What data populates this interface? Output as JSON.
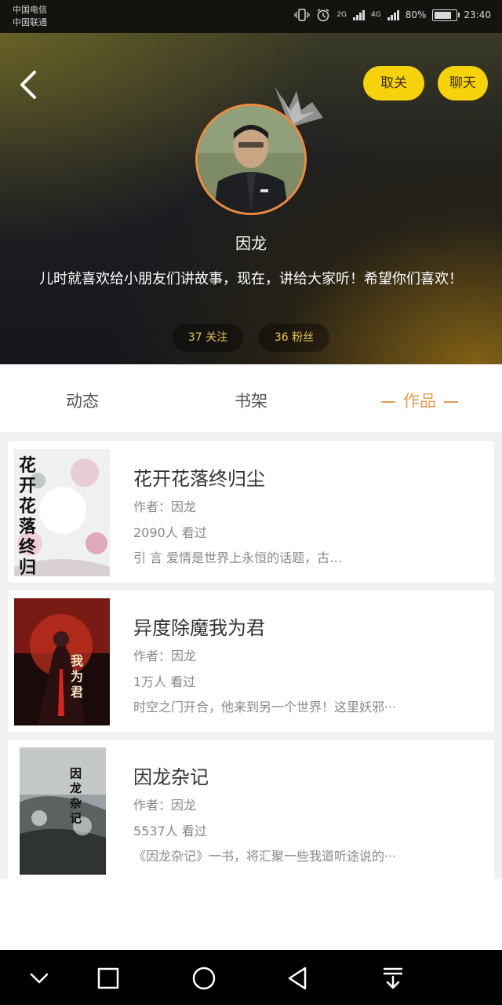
{
  "status_bar": {
    "carrier1": "中国电信",
    "carrier2": "中国联通",
    "net1": "2G",
    "net2": "4G",
    "battery_pct": "80%",
    "time": "23:40"
  },
  "header": {
    "follow_label": "取关",
    "chat_label": "聊天",
    "name": "因龙",
    "bio": "儿时就喜欢给小朋友们讲故事，现在，讲给大家听！希望你们喜欢！",
    "follows_count": "37",
    "follows_label": "关注",
    "fans_count": "36",
    "fans_label": "粉丝"
  },
  "tabs": [
    {
      "label": "动态"
    },
    {
      "label": "书架"
    },
    {
      "label": "作品"
    }
  ],
  "books": [
    {
      "title": "花开花落终归尘",
      "author": "作者：因龙",
      "views": "2090人 看过",
      "desc": "引 言 爱情是世界上永恒的话题，古…",
      "cover_text": "花开花落终归尘"
    },
    {
      "title": "异度除魔我为君",
      "author": "作者：因龙",
      "views": "1万人 看过",
      "desc": "时空之门开合，他来到另一个世界！这里妖邪···",
      "cover_text": "我为君"
    },
    {
      "title": "因龙杂记",
      "author": "作者：因龙",
      "views": "5537人 看过",
      "desc": "《因龙杂记》一书，将汇聚一些我道听途说的···",
      "cover_text": "因龙杂记"
    }
  ],
  "colors": {
    "accent_yellow": "#f5d20a",
    "tab_active": "#e89a4e",
    "avatar_ring": "#f08a3e"
  }
}
